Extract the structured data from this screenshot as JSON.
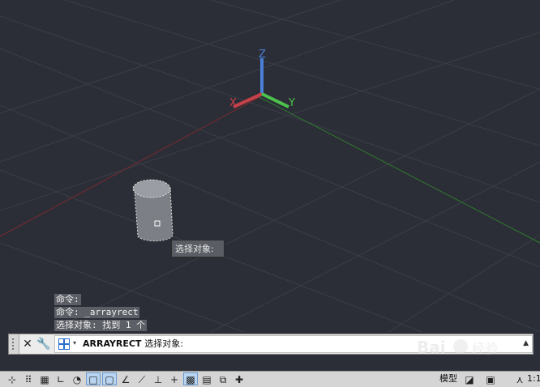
{
  "viewport": {
    "axes": {
      "x_label": "X",
      "y_label": "Y",
      "z_label": "Z"
    },
    "tooltip": "选择对象:"
  },
  "history": {
    "lines": [
      "命令:",
      "命令: _arrayrect",
      "选择对象: 找到 1 个"
    ]
  },
  "command_line": {
    "command": "ARRAYRECT",
    "prompt": "选择对象:"
  },
  "statusbar": {
    "model_label": "模型",
    "scale": "1:1"
  },
  "watermark": {
    "text": "Bai 经验",
    "sub": "jingyan.baidu.com"
  },
  "colors": {
    "background": "#2b2e36",
    "x_axis": "#c8414a",
    "y_axis": "#4cc24c",
    "z_axis": "#4a7fd8"
  }
}
